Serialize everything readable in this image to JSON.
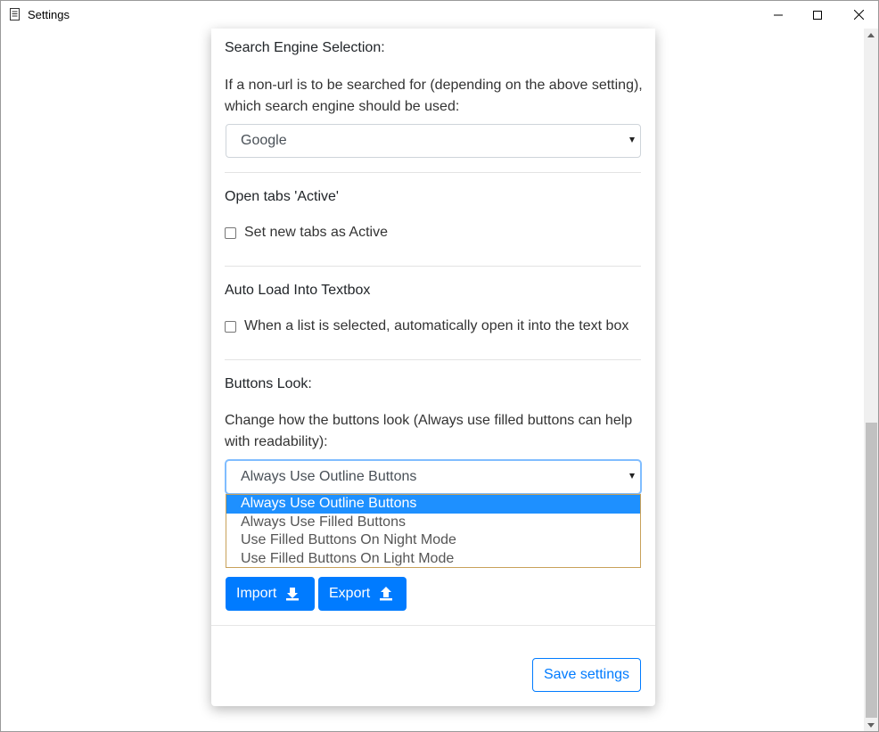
{
  "window": {
    "title": "Settings"
  },
  "search_engine": {
    "title": "Search Engine Selection:",
    "description": "If a non-url is to be searched for (depending on the above setting), which search engine should be used:",
    "selected": "Google"
  },
  "open_tabs": {
    "title": "Open tabs 'Active'",
    "checkbox_label": "Set new tabs as Active",
    "checked": false
  },
  "auto_load": {
    "title": "Auto Load Into Textbox",
    "checkbox_label": "When a list is selected, automatically open it into the text box",
    "checked": false
  },
  "buttons_look": {
    "title": "Buttons Look:",
    "description": "Change how the buttons look (Always use filled buttons can help with readability):",
    "selected": "Always Use Outline Buttons",
    "options": [
      "Always Use Outline Buttons",
      "Always Use Filled Buttons",
      "Use Filled Buttons On Night Mode",
      "Use Filled Buttons On Light Mode"
    ]
  },
  "actions": {
    "import_label": "Import",
    "export_label": "Export",
    "save_label": "Save settings"
  },
  "colors": {
    "primary": "#007bff",
    "dropdown_highlight": "#1e90ff"
  }
}
